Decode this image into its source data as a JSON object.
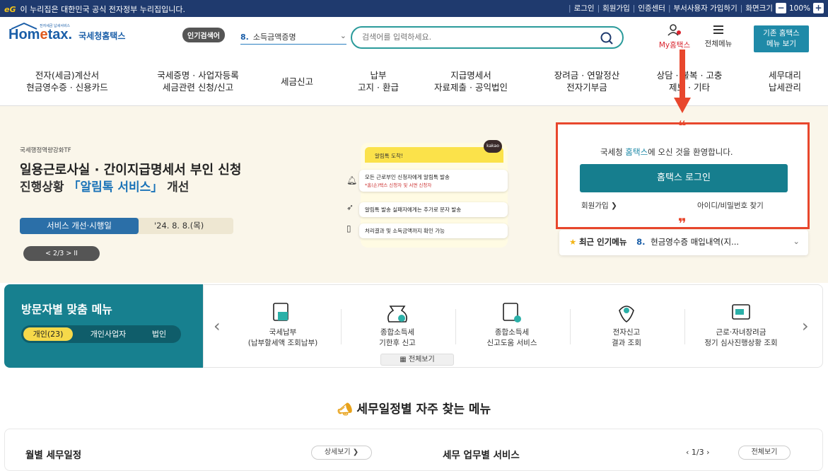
{
  "topbar": {
    "eg_logo": "eG",
    "notice": "이 누리집은 대한민국 공식 전자정부 누리집입니다.",
    "links": [
      "로그인",
      "회원가입",
      "인증센터",
      "부서사용자 가입하기",
      "화면크기"
    ],
    "zoom_minus": "−",
    "zoom_level": "100%",
    "zoom_plus": "+"
  },
  "header": {
    "logo_main": "Hom",
    "logo_e": "e",
    "logo_tax": "tax.",
    "logo_sub": "국세청홈택스",
    "logo_tiny": "전자세금 납세서비스",
    "hot_badge": "인기검색어",
    "hot_number": "8.",
    "hot_keyword": "소득금액증명",
    "search_placeholder": "검색어를 입력하세요.",
    "my_hometax": "My홈택스",
    "all_menu": "전체메뉴",
    "old_menu_line1": "기존 홈택스",
    "old_menu_line2": "메뉴 보기"
  },
  "nav": [
    {
      "l1": "전자(세금)계산서",
      "l2": "현금영수증 · 신용카드"
    },
    {
      "l1": "국세증명 · 사업자등록",
      "l2": "세금관련 신청/신고"
    },
    {
      "l1": "세금신고",
      "l2": ""
    },
    {
      "l1": "납부",
      "l2": "고지 · 환급"
    },
    {
      "l1": "지급명세서",
      "l2": "자료제출 · 공익법인"
    },
    {
      "l1": "장려금 · 연말정산",
      "l2": "전자기부금"
    },
    {
      "l1": "상담 · 불복 · 고충",
      "l2": "제보 · 기타"
    },
    {
      "l1": "세무대리",
      "l2": "납세관리"
    }
  ],
  "hero": {
    "tf": "국세행정역량강화TF",
    "title1": "일용근로사실 · 간이지급명세서 부인 신청",
    "title2_pre": "진행상황 ",
    "title2_hl": "「알림톡 서비스」",
    "title2_post": " 개선",
    "service_label": "서비스 개선·시행일",
    "service_date": "'24. 8. 8.(목)",
    "pager": "<  2/3  >  II",
    "alim_head": "알림톡 도착!",
    "kakao": "kakao",
    "msg1": "모든 근로부인 신청자",
    "msg1b": "에게 알림톡 발송",
    "msg1sub": "*홈(손)택스 신청자 및 서면 신청자",
    "msg2": "알림톡 발송 실패자에게는 추가로 문자 발송",
    "msg3": "처리결과 및 소득금액까지 확인 가능"
  },
  "login": {
    "welcome_pre": "국세청 ",
    "welcome_ht": "홈택스",
    "welcome_post": "에 오신 것을 환영합니다.",
    "login_button": "홈택스 로그인",
    "join": "회원가입 ❯",
    "find": "아이디/비밀번호 찾기",
    "quote_open": "❝",
    "quote_close": "❞"
  },
  "popular": {
    "label": "최근 인기메뉴",
    "number": "8.",
    "item": "현금영수증 매입내역(지..."
  },
  "visitor": {
    "title": "방문자별 맞춤 메뉴",
    "tabs": [
      "개인(23)",
      "개인사업자",
      "법인"
    ],
    "items": [
      {
        "l1": "국세납부",
        "l2": "(납부할세액 조회납부)"
      },
      {
        "l1": "종합소득세",
        "l2": "기한후 신고"
      },
      {
        "l1": "종합소득세",
        "l2": "신고도움 서비스"
      },
      {
        "l1": "전자신고",
        "l2": "결과 조회"
      },
      {
        "l1": "근로·자녀장려금",
        "l2": "정기 심사진행상황 조회"
      }
    ],
    "all_view": "전체보기",
    "prev": "‹",
    "next": "›"
  },
  "schedule": {
    "title": "세무일정별 자주 찾는 메뉴",
    "monthly": "월별 세무일정",
    "detail": "상세보기 ❯",
    "tax_service": "세무 업무별 서비스",
    "page": "‹  1/3  ›",
    "all_view": "전체보기"
  }
}
